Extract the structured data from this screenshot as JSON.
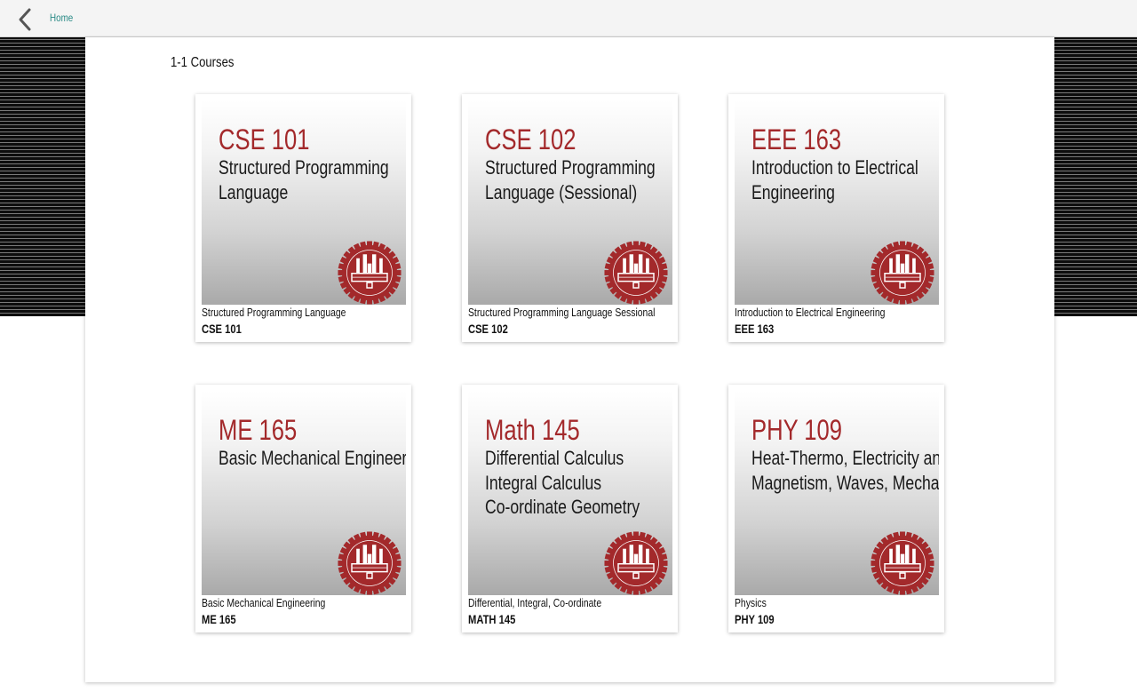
{
  "nav": {
    "back_icon": "chevron-left-icon",
    "home_label": "Home"
  },
  "section": {
    "title": "1-1 Courses"
  },
  "colors": {
    "accent_red": "#a3292b",
    "link_teal": "#2a8a86"
  },
  "courses": [
    {
      "code": "CSE 101",
      "name_lines": [
        "Structured Programming",
        "Language"
      ],
      "subtitle": "Structured Programming Language",
      "code_small": "CSE 101",
      "icon": "university-seal-icon"
    },
    {
      "code": "CSE 102",
      "name_lines": [
        "Structured Programming",
        "Language (Sessional)"
      ],
      "subtitle": "Structured Programming Language Sessional",
      "code_small": "CSE 102",
      "icon": "university-seal-icon"
    },
    {
      "code": "EEE 163",
      "name_lines": [
        "Introduction to Electrical",
        "Engineering"
      ],
      "subtitle": "Introduction to Electrical Engineering",
      "code_small": "EEE 163",
      "icon": "university-seal-icon"
    },
    {
      "code": "ME 165",
      "name_lines": [
        "Basic Mechanical Engineering"
      ],
      "subtitle": "Basic Mechanical Engineering",
      "code_small": "ME 165",
      "icon": "university-seal-icon"
    },
    {
      "code": "Math 145",
      "name_lines": [
        "Differential Calculus",
        "Integral Calculus",
        "Co-ordinate Geometry"
      ],
      "subtitle": "Differential, Integral, Co-ordinate",
      "code_small": "MATH 145",
      "icon": "university-seal-icon"
    },
    {
      "code": "PHY 109",
      "name_lines": [
        "Heat-Thermo, Electricity and",
        "Magnetism, Waves, Mechanics"
      ],
      "subtitle": "Physics",
      "code_small": "PHY 109",
      "icon": "university-seal-icon"
    }
  ]
}
